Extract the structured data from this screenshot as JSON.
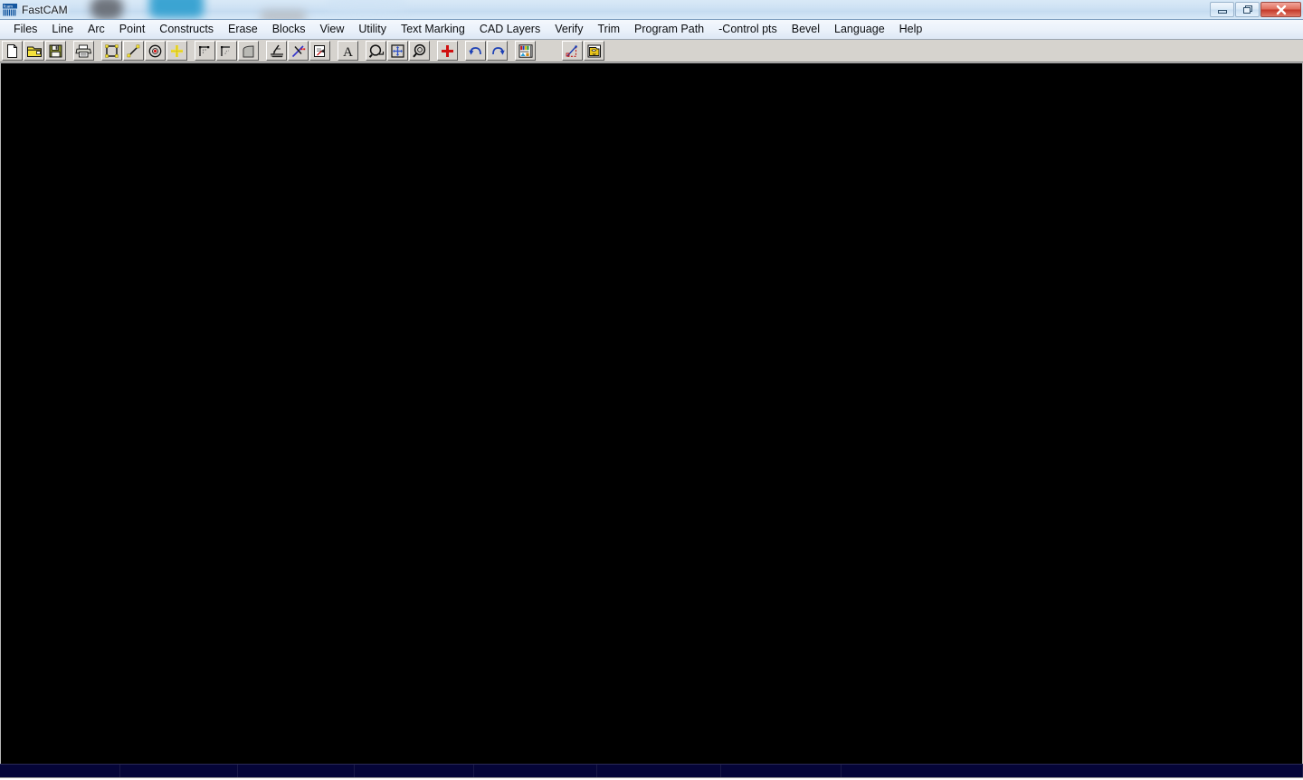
{
  "window": {
    "title": "FastCAM",
    "app_icon": "fastcam-logo-icon",
    "controls": [
      {
        "name": "minimize",
        "label": "Minimize",
        "glyph": "minimize-icon"
      },
      {
        "name": "restore",
        "label": "Restore Down",
        "glyph": "restore-icon"
      },
      {
        "name": "close",
        "label": "Close",
        "glyph": "close-icon"
      }
    ]
  },
  "menubar": {
    "items": [
      {
        "id": "files",
        "label": "Files"
      },
      {
        "id": "line",
        "label": "Line"
      },
      {
        "id": "arc",
        "label": "Arc"
      },
      {
        "id": "point",
        "label": "Point"
      },
      {
        "id": "constructs",
        "label": "Constructs"
      },
      {
        "id": "erase",
        "label": "Erase"
      },
      {
        "id": "blocks",
        "label": "Blocks"
      },
      {
        "id": "view",
        "label": "View"
      },
      {
        "id": "utility",
        "label": "Utility"
      },
      {
        "id": "text-marking",
        "label": "Text Marking"
      },
      {
        "id": "cad-layers",
        "label": "CAD Layers"
      },
      {
        "id": "verify",
        "label": "Verify"
      },
      {
        "id": "trim",
        "label": "Trim"
      },
      {
        "id": "program-path",
        "label": "Program Path"
      },
      {
        "id": "control-pts",
        "label": "-Control pts"
      },
      {
        "id": "bevel",
        "label": "Bevel"
      },
      {
        "id": "language",
        "label": "Language"
      },
      {
        "id": "help",
        "label": "Help"
      }
    ]
  },
  "toolbar": {
    "groups": [
      {
        "id": "file-group",
        "buttons": [
          {
            "id": "new",
            "icon": "new-file-icon",
            "tooltip": "New"
          },
          {
            "id": "open",
            "icon": "open-folder-icon",
            "tooltip": "Open"
          },
          {
            "id": "save",
            "icon": "save-floppy-icon",
            "tooltip": "Save"
          }
        ]
      },
      {
        "id": "print-group",
        "buttons": [
          {
            "id": "print",
            "icon": "printer-icon",
            "tooltip": "Print"
          }
        ]
      },
      {
        "id": "draw-group",
        "buttons": [
          {
            "id": "rectangle",
            "icon": "rectangle-icon",
            "tooltip": "Rectangle"
          },
          {
            "id": "line",
            "icon": "line-icon",
            "tooltip": "Line"
          },
          {
            "id": "circle",
            "icon": "circle-icon",
            "tooltip": "Circle"
          },
          {
            "id": "point",
            "icon": "point-cross-icon",
            "tooltip": "Point"
          }
        ]
      },
      {
        "id": "construct-group",
        "buttons": [
          {
            "id": "corner",
            "icon": "corner-icon",
            "tooltip": "Corner"
          },
          {
            "id": "fillet",
            "icon": "fillet-icon",
            "tooltip": "Fillet"
          },
          {
            "id": "radius-corner",
            "icon": "radius-corner-icon",
            "tooltip": "Radius Corner"
          }
        ]
      },
      {
        "id": "path-group",
        "buttons": [
          {
            "id": "lead-in",
            "icon": "lead-in-icon",
            "tooltip": "Lead In"
          },
          {
            "id": "cut-path",
            "icon": "cut-path-icon",
            "tooltip": "Cut Path"
          },
          {
            "id": "exit-path",
            "icon": "exit-path-icon",
            "tooltip": "Exit Path"
          }
        ]
      },
      {
        "id": "text-group",
        "buttons": [
          {
            "id": "text",
            "icon": "text-a-icon",
            "tooltip": "Text"
          }
        ]
      },
      {
        "id": "zoom-group",
        "buttons": [
          {
            "id": "zoom-window",
            "icon": "zoom-window-icon",
            "tooltip": "Zoom Window"
          },
          {
            "id": "zoom-extents",
            "icon": "zoom-extents-icon",
            "tooltip": "Zoom Extents"
          },
          {
            "id": "zoom-previous",
            "icon": "zoom-previous-icon",
            "tooltip": "Zoom Previous"
          }
        ]
      },
      {
        "id": "pan-group",
        "buttons": [
          {
            "id": "pan",
            "icon": "red-cross-icon",
            "tooltip": "Pan"
          }
        ]
      },
      {
        "id": "history-group",
        "buttons": [
          {
            "id": "undo",
            "icon": "undo-arrow-icon",
            "tooltip": "Undo"
          },
          {
            "id": "redo",
            "icon": "redo-arrow-icon",
            "tooltip": "Redo"
          }
        ]
      },
      {
        "id": "nest-group",
        "buttons": [
          {
            "id": "nesting",
            "icon": "nesting-chart-icon",
            "tooltip": "Nesting"
          }
        ]
      },
      {
        "id": "tools-group",
        "buttons": [
          {
            "id": "dimension",
            "icon": "dimension-icon",
            "tooltip": "Dimension"
          },
          {
            "id": "library",
            "icon": "library-folder-icon",
            "tooltip": "Part Library"
          }
        ]
      }
    ]
  },
  "canvas": {
    "name": "drawing-canvas",
    "background": "#000000"
  },
  "statusbar": {
    "background": "#050538",
    "cells": [
      "",
      "",
      "",
      "",
      "",
      "",
      "",
      ""
    ]
  }
}
